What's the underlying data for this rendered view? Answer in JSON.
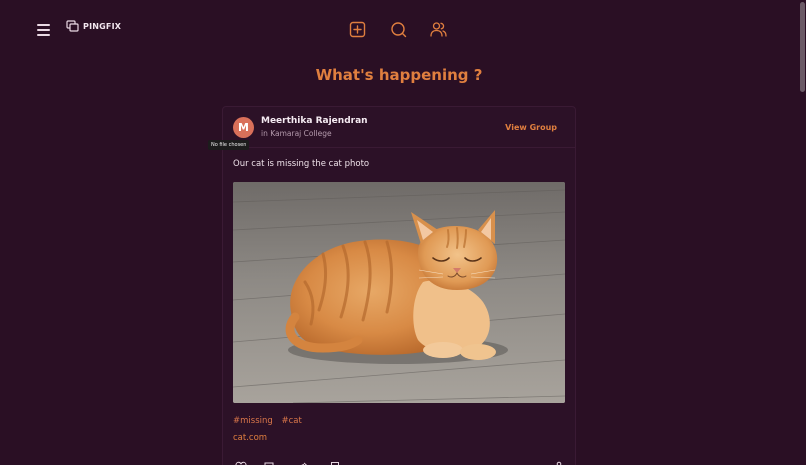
{
  "header": {
    "logo_text": "PINGFIX",
    "nav_icons": [
      "menu-icon",
      "logo-icon",
      "add-post-icon",
      "search-icon",
      "users-icon"
    ]
  },
  "main": {
    "title": "What's happening ?"
  },
  "post": {
    "avatar_initial": "M",
    "author_name": "Meerthika Rajendran",
    "group_text": "in Kamaraj College",
    "view_group_label": "View Group",
    "file_tooltip": "No file chosen",
    "text": "Our cat is missing the cat photo",
    "image_subject": "orange tabby cat lying on wooden floor",
    "tags": [
      "#missing",
      "#cat"
    ],
    "link": "cat.com",
    "action_icons": [
      "like-icon",
      "comment-icon",
      "share-icon",
      "bookmark-icon"
    ]
  },
  "colors": {
    "background": "#2a0f24",
    "accent": "#e07f3f",
    "avatar": "#d9705a",
    "text": "#f2e6ee"
  }
}
